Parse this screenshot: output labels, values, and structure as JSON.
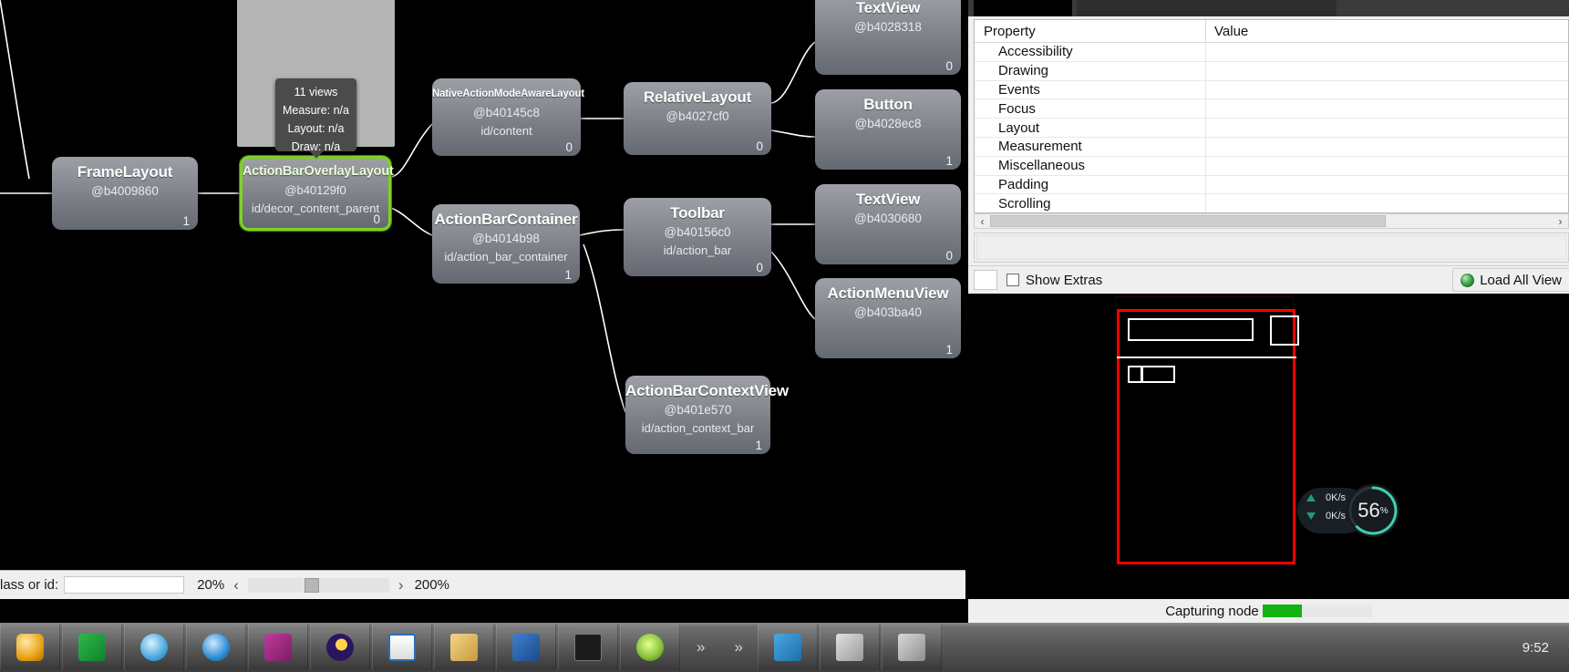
{
  "app": {
    "title": "Hierarchy Viewer"
  },
  "tree": {
    "nodes": [
      {
        "id": "framelayout",
        "cls": "FrameLayout",
        "hash": "@b4009860",
        "vid": "",
        "count": "1"
      },
      {
        "id": "overlay",
        "cls": "ActionBarOverlayLayout",
        "hash": "@b40129f0",
        "vid": "id/decor_content_parent",
        "count": "0"
      },
      {
        "id": "nativeaction",
        "cls": "NativeActionModeAwareLayout",
        "hash": "@b40145c8",
        "vid": "id/content",
        "count": "0"
      },
      {
        "id": "abcontainer",
        "cls": "ActionBarContainer",
        "hash": "@b4014b98",
        "vid": "id/action_bar_container",
        "count": "1"
      },
      {
        "id": "relativelayout",
        "cls": "RelativeLayout",
        "hash": "@b4027cf0",
        "vid": "",
        "count": "0"
      },
      {
        "id": "toolbar",
        "cls": "Toolbar",
        "hash": "@b40156c0",
        "vid": "id/action_bar",
        "count": "0"
      },
      {
        "id": "abcontext",
        "cls": "ActionBarContextView",
        "hash": "@b401e570",
        "vid": "id/action_context_bar",
        "count": "1"
      },
      {
        "id": "textview1",
        "cls": "TextView",
        "hash": "@b4028318",
        "vid": "",
        "count": "0"
      },
      {
        "id": "button",
        "cls": "Button",
        "hash": "@b4028ec8",
        "vid": "",
        "count": "1"
      },
      {
        "id": "textview2",
        "cls": "TextView",
        "hash": "@b4030680",
        "vid": "",
        "count": "0"
      },
      {
        "id": "actionmenu",
        "cls": "ActionMenuView",
        "hash": "@b403ba40",
        "vid": "",
        "count": "1"
      }
    ],
    "tooltip": {
      "views": "11 views",
      "measure": "Measure: n/a",
      "layout": "Layout: n/a",
      "draw": "Draw: n/a"
    },
    "selected_accent": "#7ed321"
  },
  "toolbar": {
    "filter_label": "lass or id:",
    "filter_value": "",
    "filter_placeholder": "",
    "zoom_min": "20%",
    "zoom_max": "200%",
    "prev_icon": "chevron-left-icon",
    "next_icon": "chevron-right-icon"
  },
  "properties": {
    "col_property": "Property",
    "col_value": "Value",
    "rows": [
      {
        "name": "Accessibility",
        "value": ""
      },
      {
        "name": "Drawing",
        "value": ""
      },
      {
        "name": "Events",
        "value": ""
      },
      {
        "name": "Focus",
        "value": ""
      },
      {
        "name": "Layout",
        "value": ""
      },
      {
        "name": "Measurement",
        "value": ""
      },
      {
        "name": "Miscellaneous",
        "value": ""
      },
      {
        "name": "Padding",
        "value": ""
      },
      {
        "name": "Scrolling",
        "value": ""
      }
    ]
  },
  "extras": {
    "show_extras_label": "Show Extras",
    "load_all_views_label": "Load All View",
    "globe_icon": "globe-icon"
  },
  "status": {
    "text": "Capturing node",
    "progress_percent": 36
  },
  "network_widget": {
    "upload": "0K/s",
    "download": "0K/s",
    "cpu_percent": "56",
    "percent_symbol": "%",
    "accent": "#3fd0b0"
  },
  "taskbar": {
    "chevrons": [
      "»",
      "»"
    ],
    "clock": "9:52"
  }
}
